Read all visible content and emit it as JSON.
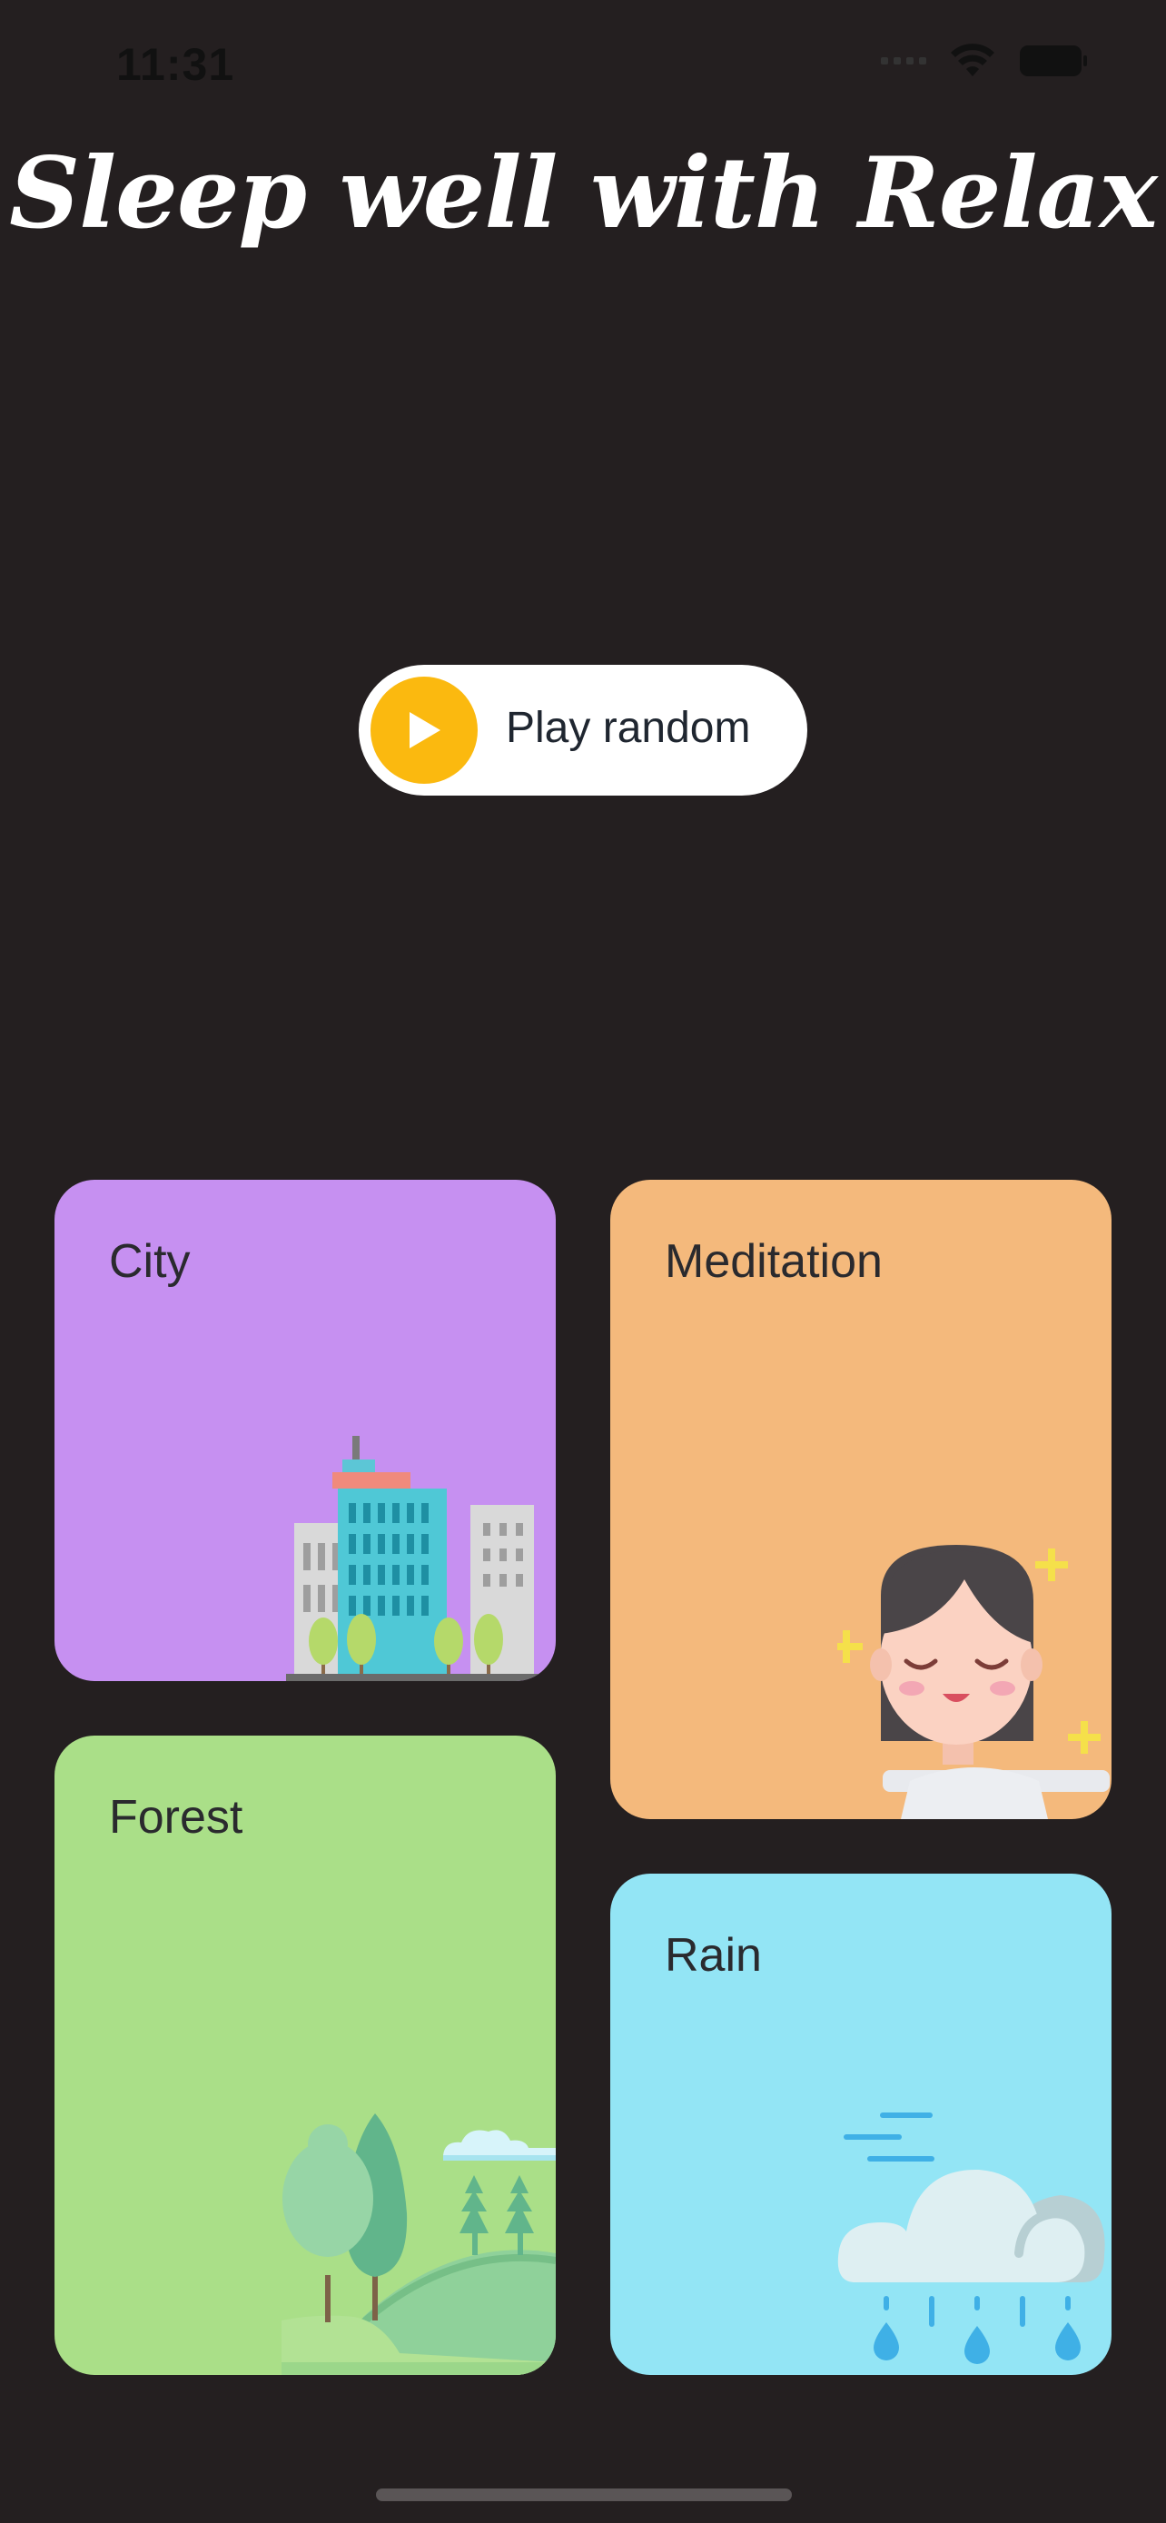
{
  "status_bar": {
    "time": "11:31",
    "icons": [
      "signal-icon",
      "wifi-icon",
      "battery-icon"
    ]
  },
  "header": {
    "title": "Sleep well with Relax"
  },
  "play_button": {
    "label": "Play random",
    "icon": "play-icon",
    "accent": "#fbb90f"
  },
  "categories": [
    {
      "label": "City",
      "color": "#c690f1",
      "illustration": "city-illustration"
    },
    {
      "label": "Meditation",
      "color": "#f4b97c",
      "illustration": "meditation-illustration"
    },
    {
      "label": "Forest",
      "color": "#aadf88",
      "illustration": "forest-illustration"
    },
    {
      "label": "Rain",
      "color": "#93e5f5",
      "illustration": "rain-illustration"
    }
  ],
  "colors": {
    "background": "#241f20"
  }
}
